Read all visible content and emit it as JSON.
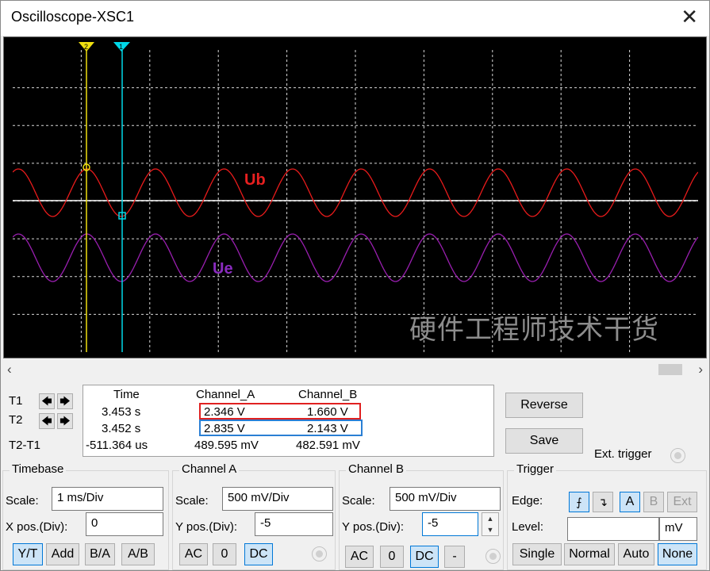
{
  "window": {
    "title": "Oscilloscope-XSC1",
    "close_glyph": "✕"
  },
  "screen": {
    "label_ub": "Ub",
    "label_ue": "Ue",
    "watermark": "硬件工程师技术干货",
    "cursor1_label": "1",
    "cursor2_label": "2",
    "colors": {
      "channel_a": "#e81b1b",
      "channel_b": "#9a1fb0",
      "cursor1": "#00d8e8",
      "cursor2": "#f0e010",
      "grid": "#d8d8d8",
      "label_ub": "#e82020",
      "label_ue": "#8a2bbf"
    }
  },
  "scroll": {
    "left_glyph": "‹",
    "right_glyph": "›"
  },
  "cursors": {
    "t1": "T1",
    "t2": "T2",
    "t2t1": "T2-T1",
    "left_glyph": "🡄",
    "right_glyph": "🡆"
  },
  "readout": {
    "headers": {
      "time": "Time",
      "channel_a": "Channel_A",
      "channel_b": "Channel_B"
    },
    "rows": [
      {
        "time": "3.453 s",
        "a": "2.346 V",
        "b": "1.660 V"
      },
      {
        "time": "3.452 s",
        "a": "2.835 V",
        "b": "2.143 V"
      },
      {
        "time": "-511.364 us",
        "a": "489.595 mV",
        "b": "482.591 mV"
      }
    ]
  },
  "actions": {
    "reverse": "Reverse",
    "save": "Save",
    "ext_trigger": "Ext. trigger"
  },
  "timebase": {
    "title": "Timebase",
    "scale_label": "Scale:",
    "scale_value": "1 ms/Div",
    "xpos_label": "X pos.(Div):",
    "xpos_value": "0",
    "modes": [
      "Y/T",
      "Add",
      "B/A",
      "A/B"
    ],
    "selected_mode": "Y/T"
  },
  "channel_a": {
    "title": "Channel A",
    "scale_label": "Scale:",
    "scale_value": "500 mV/Div",
    "ypos_label": "Y pos.(Div):",
    "ypos_value": "-5",
    "coupling": [
      "AC",
      "0",
      "DC"
    ],
    "selected_coupling": "DC"
  },
  "channel_b": {
    "title": "Channel B",
    "scale_label": "Scale:",
    "scale_value": "500 mV/Div",
    "ypos_label": "Y pos.(Div):",
    "ypos_value": "-5",
    "coupling": [
      "AC",
      "0",
      "DC",
      "-"
    ],
    "selected_coupling": "DC"
  },
  "trigger": {
    "title": "Trigger",
    "edge_label": "Edge:",
    "level_label": "Level:",
    "level_value": "",
    "level_unit": "mV",
    "edge_rising_glyph": "⨍",
    "edge_falling_glyph": "↴",
    "sources": [
      "A",
      "B",
      "Ext"
    ],
    "selected_source": "A",
    "modes": [
      "Single",
      "Normal",
      "Auto",
      "None"
    ],
    "selected_mode": "None"
  }
}
